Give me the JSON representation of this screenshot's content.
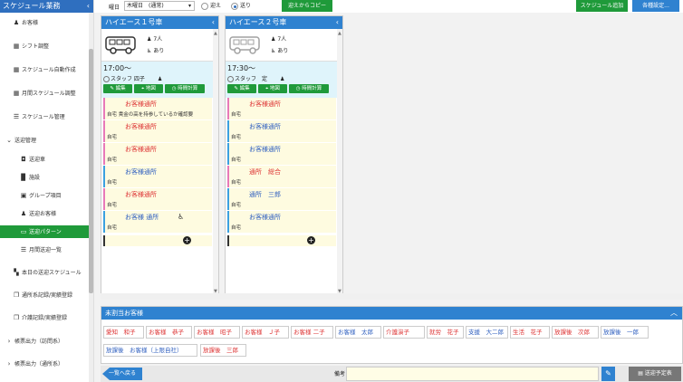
{
  "sidebar": {
    "title": "スケジュール業務",
    "items": [
      {
        "label": "お客様",
        "icon": "person-icon"
      },
      {
        "label": "シフト調整",
        "icon": "calendar-icon"
      },
      {
        "label": "スケジュール自動作成",
        "icon": "calendar-icon"
      },
      {
        "label": "月間スケジュール調整",
        "icon": "grid-icon"
      },
      {
        "label": "スケジュール管理",
        "icon": "list-icon"
      },
      {
        "label": "送迎管理",
        "icon": "chevron-down-icon"
      },
      {
        "label": "送迎車",
        "icon": "car-icon"
      },
      {
        "label": "施設",
        "icon": "building-icon"
      },
      {
        "label": "グループ項目",
        "icon": "image-icon"
      },
      {
        "label": "送迎お客様",
        "icon": "people-icon"
      },
      {
        "label": "送迎パターン",
        "icon": "ticket-icon"
      },
      {
        "label": "月間送迎一覧",
        "icon": "list-icon"
      },
      {
        "label": "本日の送迎スケジュール",
        "icon": "map-icon"
      },
      {
        "label": "通所系記録/実績登録",
        "icon": "copy-icon"
      },
      {
        "label": "介護記録/実績登録",
        "icon": "copy-icon"
      },
      {
        "label": "帳票出力（訪問系）",
        "icon": "chevron-right-icon"
      },
      {
        "label": "帳票出力（通所系）",
        "icon": "chevron-right-icon"
      }
    ]
  },
  "toolbar": {
    "day_label": "曜日",
    "day_value": "木曜日　(通常)",
    "radio_pickup": "迎え",
    "radio_dropoff": "送り",
    "copy_button": "迎えからコピー",
    "add_schedule_button": "スケジュール追加",
    "settings_button": "各種設定..."
  },
  "vehicles": [
    {
      "name": "ハイエース１号車",
      "capacity": "7人",
      "wheelchair": "あり",
      "time": "17:00〜",
      "staff": "スタッフ 四子",
      "buttons": [
        "編集",
        "地図",
        "時間計算"
      ],
      "stops": [
        {
          "name": "お客様通所",
          "address": "自宅 貴金の高を持参しているか確認要",
          "color": "pink",
          "wheelchair": false
        },
        {
          "name": "お客様通所",
          "address": "自宅",
          "color": "pink",
          "wheelchair": false
        },
        {
          "name": "お客様通所",
          "address": "自宅",
          "color": "pink",
          "wheelchair": false
        },
        {
          "name": "お客様通所",
          "address": "自宅",
          "color": "blue",
          "wheelchair": false,
          "blue_name": true
        },
        {
          "name": "お客様通所",
          "address": "自宅",
          "color": "pink",
          "wheelchair": false
        },
        {
          "name": "お客様 通所",
          "address": "自宅",
          "color": "blue",
          "wheelchair": true,
          "blue_name": true
        }
      ]
    },
    {
      "name": "ハイエース２号車",
      "capacity": "7人",
      "wheelchair": "あり",
      "time": "17:30〜",
      "staff": "スタッフ　定",
      "buttons": [
        "編集",
        "地図",
        "時間計算"
      ],
      "stops": [
        {
          "name": "お客様通所",
          "address": "自宅",
          "color": "pink",
          "wheelchair": false
        },
        {
          "name": "お客様通所",
          "address": "自宅",
          "color": "blue",
          "wheelchair": false,
          "blue_name": true
        },
        {
          "name": "お客様通所",
          "address": "自宅",
          "color": "blue",
          "wheelchair": false,
          "blue_name": true
        },
        {
          "name": "通所　総合",
          "address": "自宅",
          "color": "pink",
          "wheelchair": false
        },
        {
          "name": "通所　三郎",
          "address": "自宅",
          "color": "blue",
          "wheelchair": false,
          "blue_name": true
        },
        {
          "name": "お客様通所",
          "address": "自宅",
          "color": "blue",
          "wheelchair": false,
          "blue_name": true
        }
      ]
    }
  ],
  "unassigned": {
    "title": "未割当お客様",
    "chips": [
      {
        "label": "愛知　和子",
        "blue": false
      },
      {
        "label": "お客様　恭子",
        "blue": false
      },
      {
        "label": "お客様　昭子",
        "blue": false
      },
      {
        "label": "お客様　Ｊ子",
        "blue": false
      },
      {
        "label": "お客様 二子",
        "blue": false
      },
      {
        "label": "お客様　太郎",
        "blue": true
      },
      {
        "label": "介護演子",
        "blue": false
      },
      {
        "label": "就労　花子",
        "blue": false
      },
      {
        "label": "支援　大二郎",
        "blue": true
      },
      {
        "label": "生活　花子",
        "blue": false
      },
      {
        "label": "放課後　次郎",
        "blue": false
      },
      {
        "label": "放課後　一郎",
        "blue": true
      },
      {
        "label": "放課後　お客様（上限自社）",
        "blue": true
      },
      {
        "label": "放課後　三郎",
        "blue": false
      }
    ]
  },
  "bottombar": {
    "back_button": "一覧へ戻る",
    "memo_label": "備考",
    "memo_value": "",
    "pdf_button": "送迎予定表"
  }
}
